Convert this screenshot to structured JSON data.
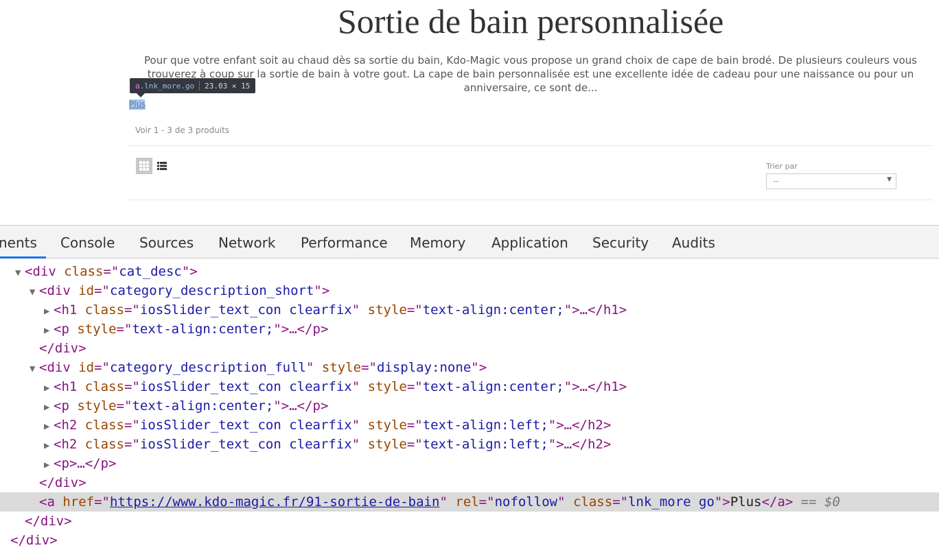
{
  "page": {
    "title": "Sortie de bain personnalisée",
    "description": "Pour que votre enfant soit au chaud dès sa sortie du bain, Kdo-Magic vous propose un grand choix de cape de bain brodé. De plusieurs couleurs vous trouverez à coup sur la sortie de bain à votre gout. La cape de bain personnalisée est une excellente idée de cadeau pour une naissance ou pour un anniversaire, ce sont de...",
    "more_link": "Plus",
    "product_count": "Voir 1 - 3 de 3 produits",
    "sort_label": "Trier par",
    "sort_value": "--",
    "view_icons": [
      "grid-view-icon",
      "list-view-icon"
    ]
  },
  "inspect_tooltip": {
    "selector_tag": "a",
    "selector_class": ".lnk_more.go",
    "dimensions": "23.03 × 15"
  },
  "devtools": {
    "tabs": [
      "nents",
      "Console",
      "Sources",
      "Network",
      "Performance",
      "Memory",
      "Application",
      "Security",
      "Audits"
    ],
    "active_tab": "nents",
    "dom_lines": [
      {
        "tag_open": "<div",
        "attrs": [
          [
            "class",
            "cat_desc"
          ]
        ],
        "rest": ">"
      },
      {
        "tag_open": "<div",
        "attrs": [
          [
            "id",
            "category_description_short"
          ]
        ],
        "rest": ">"
      },
      {
        "tag_open": "<h1",
        "attrs": [
          [
            "class",
            "iosSlider_text_con clearfix"
          ],
          [
            "style",
            "text-align:center;"
          ]
        ],
        "rest": ">…</h1>"
      },
      {
        "tag_open": "<p",
        "attrs": [
          [
            "style",
            "text-align:center;"
          ]
        ],
        "rest": ">…</p>"
      },
      {
        "tag_open": "</div>",
        "attrs": [],
        "rest": ""
      },
      {
        "tag_open": "<div",
        "attrs": [
          [
            "id",
            "category_description_full"
          ],
          [
            "style",
            "display:none"
          ]
        ],
        "rest": ">"
      },
      {
        "tag_open": "<h1",
        "attrs": [
          [
            "class",
            "iosSlider_text_con clearfix"
          ],
          [
            "style",
            "text-align:center;"
          ]
        ],
        "rest": ">…</h1>"
      },
      {
        "tag_open": "<p",
        "attrs": [
          [
            "style",
            "text-align:center;"
          ]
        ],
        "rest": ">…</p>"
      },
      {
        "tag_open": "<h2",
        "attrs": [
          [
            "class",
            "iosSlider_text_con clearfix"
          ],
          [
            "style",
            "text-align:left;"
          ]
        ],
        "rest": ">…</h2>"
      },
      {
        "tag_open": "<h2",
        "attrs": [
          [
            "class",
            "iosSlider_text_con clearfix"
          ],
          [
            "style",
            "text-align:left;"
          ]
        ],
        "rest": ">…</h2>"
      },
      {
        "tag_open": "<p",
        "attrs": [],
        "rest": ">…</p>"
      },
      {
        "tag_open": "</div>",
        "attrs": [],
        "rest": ""
      },
      {
        "tag_open": "<a",
        "attrs": [
          [
            "href",
            "https://www.kdo-magic.fr/91-sortie-de-bain"
          ],
          [
            "rel",
            "nofollow"
          ],
          [
            "class",
            "lnk_more go"
          ]
        ],
        "rest": ">",
        "text": "Plus",
        "close": "</a>",
        "suffix": " == $0"
      },
      {
        "tag_open": "</div>",
        "attrs": [],
        "rest": ""
      },
      {
        "tag_open": "</div>",
        "attrs": [],
        "rest": ""
      }
    ]
  }
}
